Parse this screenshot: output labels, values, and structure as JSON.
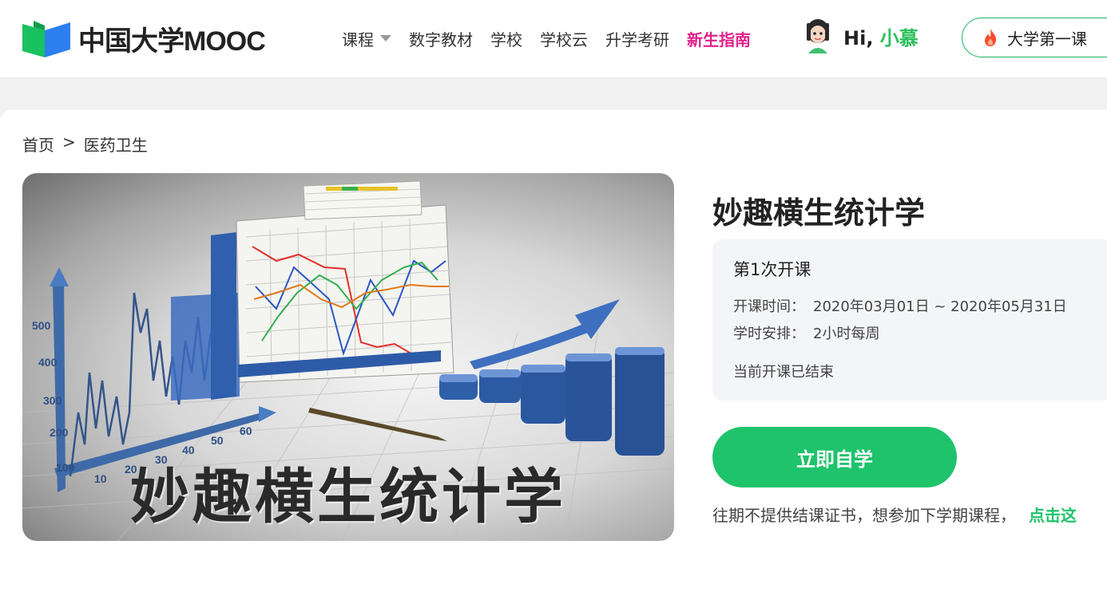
{
  "header": {
    "logo_text": "中国大学MOOC",
    "nav": [
      {
        "label": "课程",
        "has_dropdown": true
      },
      {
        "label": "数字教材"
      },
      {
        "label": "学校"
      },
      {
        "label": "学校云"
      },
      {
        "label": "升学考研"
      },
      {
        "label": "新生指南",
        "highlight": true
      }
    ],
    "greeting_prefix": "Hi,",
    "greeting_name": "小慕",
    "first_lesson_label": "大学第一课"
  },
  "breadcrumb": {
    "home": "首页",
    "separator": ">",
    "category": "医药卫生"
  },
  "cover": {
    "title_text": "妙趣横生统计学",
    "axis_labels_y": [
      "500",
      "400",
      "300",
      "200",
      "100"
    ],
    "axis_labels_x": [
      "10",
      "20",
      "30",
      "40",
      "50",
      "60"
    ]
  },
  "course": {
    "title": "妙趣横生统计学",
    "term_name": "第1次开课",
    "start_label": "开课时间：",
    "start_value": "2020年03月01日 ~ 2020年05月31日",
    "hours_label": "学时安排：",
    "hours_value": "2小时每周",
    "status": "当前开课已结束",
    "study_button": "立即自学",
    "notice_text": "往期不提供结课证书，想参加下学期课程，",
    "notice_link": "点击这"
  },
  "colors": {
    "accent_green": "#1ec36b",
    "highlight_pink": "#e0218a"
  }
}
